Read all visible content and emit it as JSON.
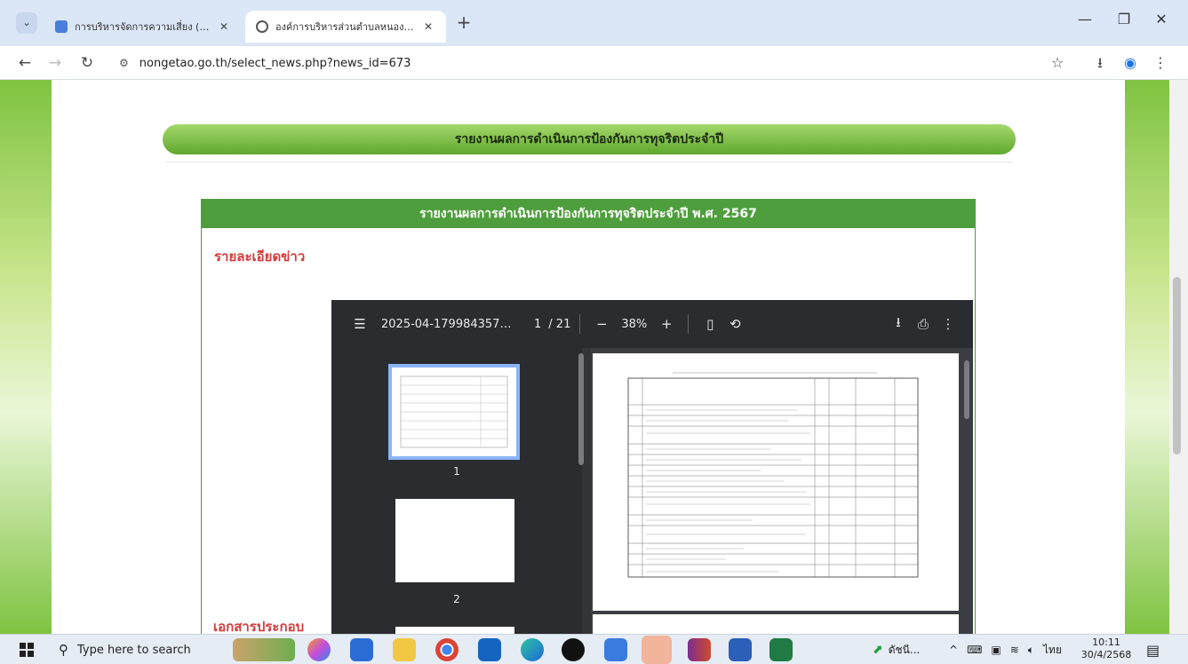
{
  "browser": {
    "tabs": [
      {
        "title": "การบริหารจัดการความเสี่ยง (หลักฐ...",
        "active": false
      },
      {
        "title": "องค์การบริหารส่วนตำบลหนองอีเฒ่า",
        "active": true
      }
    ],
    "tab_close": "✕",
    "new_tab": "+",
    "url": "nongetao.go.th/select_news.php?news_id=673",
    "accent": "#dbe6f6"
  },
  "page": {
    "section_title": "รายงานผลการดำเนินการป้องกันการทุจริตประจำปี",
    "news_header": "รายงานผลการดำเนินการป้องกันการทุจริตประจำปี พ.ศ. 2567",
    "news_detail_label": "รายละเอียดข่าว",
    "attachments_label": "เอกสารประกอบ",
    "colors": {
      "green": "#4f9e3d",
      "label_red": "#d63a3a"
    }
  },
  "pdf_viewer": {
    "file_name": "2025-04-17998435746...",
    "page_current": "1",
    "page_total": "/ 21",
    "zoom": "38%",
    "zoom_out": "−",
    "zoom_in": "+",
    "thumbnails": [
      {
        "label": "1"
      },
      {
        "label": "2"
      }
    ]
  },
  "taskbar": {
    "search_placeholder": "Type here to search",
    "tray_item": "ดัชนี...",
    "language": "ไทย",
    "time": "10:11",
    "date": "30/4/2568"
  }
}
